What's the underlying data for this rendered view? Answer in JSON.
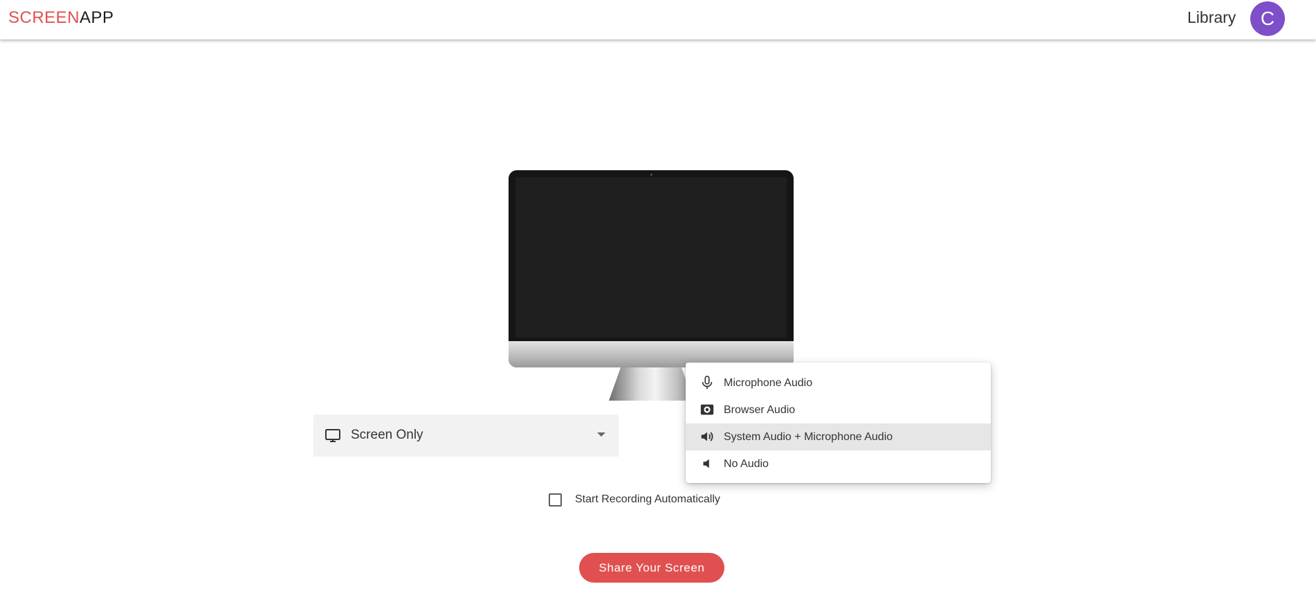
{
  "header": {
    "logo": {
      "part1": "SCREEN",
      "part2": "APP"
    },
    "library_label": "Library",
    "avatar_initial": "C"
  },
  "screen_select": {
    "selected": "Screen Only",
    "icon": "monitor-icon"
  },
  "audio_menu": {
    "items": [
      {
        "label": "Microphone Audio",
        "icon": "microphone-icon",
        "selected": false
      },
      {
        "label": "Browser Audio",
        "icon": "browser-audio-icon",
        "selected": false
      },
      {
        "label": "System Audio + Microphone Audio",
        "icon": "volume-up-icon",
        "selected": true
      },
      {
        "label": "No Audio",
        "icon": "volume-mute-icon",
        "selected": false
      }
    ]
  },
  "auto_record": {
    "label": "Start Recording Automatically",
    "checked": false
  },
  "share_button_label": "Share Your Screen",
  "colors": {
    "brand": "#e05050",
    "avatar": "#7e4fc8"
  }
}
